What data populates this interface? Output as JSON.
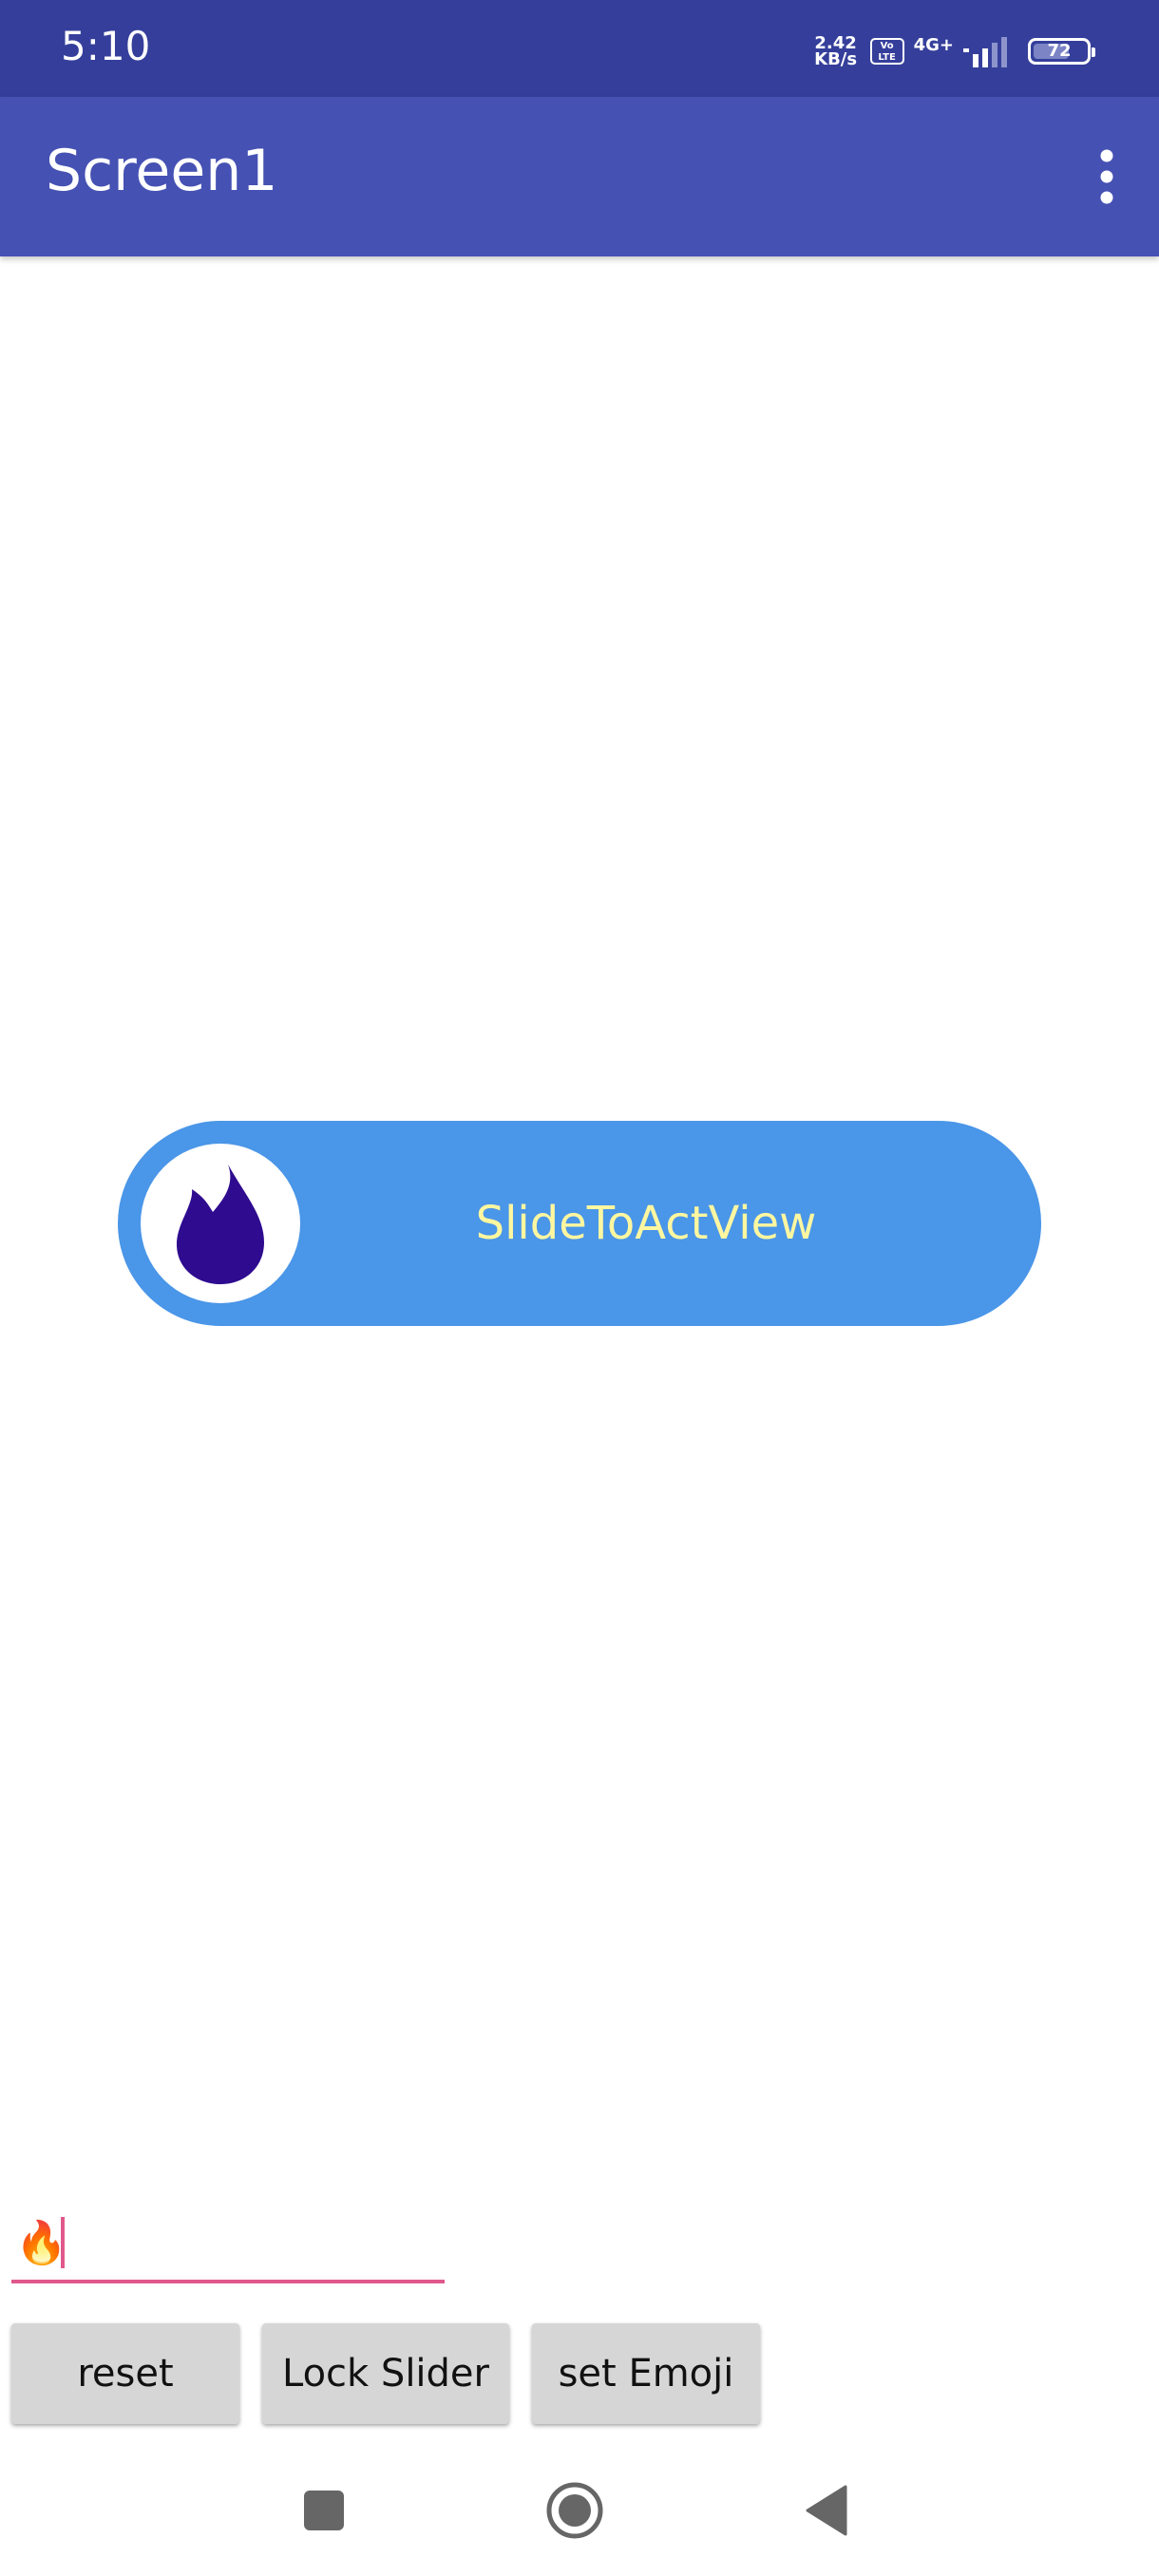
{
  "status_bar": {
    "time": "5:10",
    "net_speed_value": "2.42",
    "net_speed_unit": "KB/s",
    "volte_top": "Vo",
    "volte_bottom": "LTE",
    "network_type": "4G+",
    "battery_percent": "72",
    "battery_level": 0.72,
    "icons": [
      "volte-icon",
      "signal-icon",
      "battery-icon"
    ]
  },
  "app_bar": {
    "title": "Screen1",
    "overflow_icon": "more-vert-icon"
  },
  "slider": {
    "label": "SlideToActView",
    "knob_icon": "fire-icon",
    "colors": {
      "track": "#4a96e8",
      "text": "#fff7a0",
      "icon": "#2e0b8f",
      "knob": "#ffffff"
    }
  },
  "input": {
    "value": "🔥",
    "accent_color": "#e0588c"
  },
  "buttons": {
    "reset": "reset",
    "lock_slider": "Lock Slider",
    "set_emoji": "set Emoji"
  },
  "nav_bar": {
    "icons": [
      "recents-square-icon",
      "home-circle-icon",
      "back-triangle-icon"
    ]
  },
  "colors": {
    "status_bar": "#353f9b",
    "app_bar": "#4551b3"
  }
}
